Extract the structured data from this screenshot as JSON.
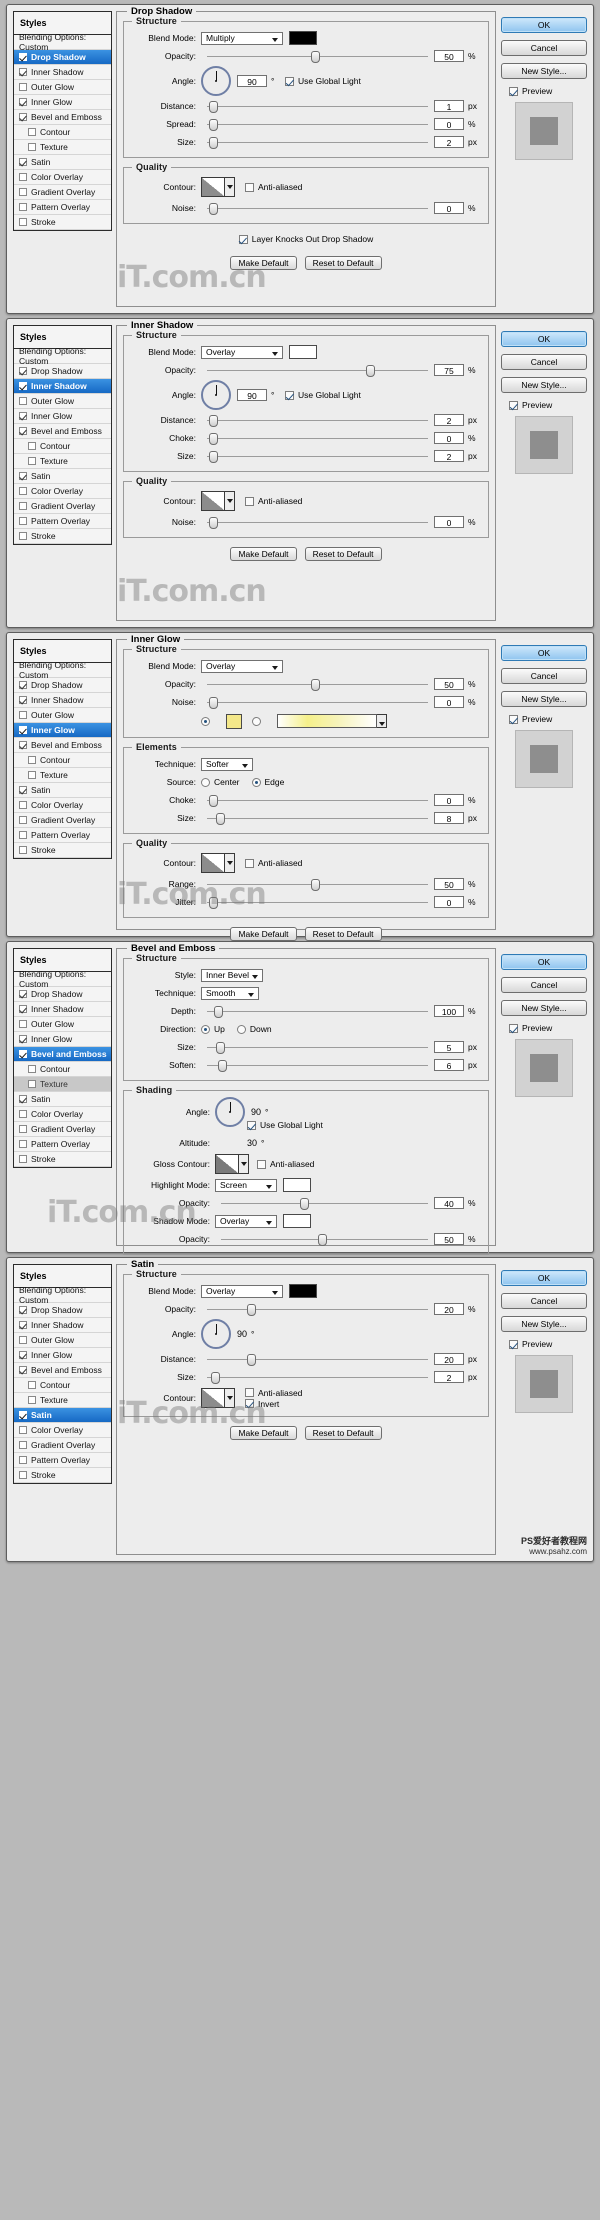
{
  "app": {
    "watermark": "iT.com.cn",
    "footer_line1": "PS爱好者教程网",
    "footer_line2": "www.psahz.com"
  },
  "common": {
    "styles_header": "Styles",
    "blending_options": "Blending Options: Custom",
    "style_items": [
      "Drop Shadow",
      "Inner Shadow",
      "Outer Glow",
      "Inner Glow",
      "Bevel and Emboss",
      "Contour",
      "Texture",
      "Satin",
      "Color Overlay",
      "Gradient Overlay",
      "Pattern Overlay",
      "Stroke"
    ],
    "buttons": {
      "ok": "OK",
      "cancel": "Cancel",
      "new_style": "New Style...",
      "preview": "Preview",
      "make_default": "Make Default",
      "reset_default": "Reset to Default"
    },
    "labels": {
      "structure": "Structure",
      "quality": "Quality",
      "elements": "Elements",
      "shading": "Shading",
      "blend_mode": "Blend Mode:",
      "opacity": "Opacity:",
      "angle": "Angle:",
      "distance": "Distance:",
      "spread": "Spread:",
      "size": "Size:",
      "choke": "Choke:",
      "noise": "Noise:",
      "contour": "Contour:",
      "anti_aliased": "Anti-aliased",
      "use_global_light": "Use Global Light",
      "layer_knocks_out": "Layer Knocks Out Drop Shadow",
      "technique": "Technique:",
      "source": "Source:",
      "center": "Center",
      "edge": "Edge",
      "range": "Range:",
      "jitter": "Jitter:",
      "style": "Style:",
      "depth": "Depth:",
      "direction": "Direction:",
      "up": "Up",
      "down": "Down",
      "soften": "Soften:",
      "altitude": "Altitude:",
      "gloss_contour": "Gloss Contour:",
      "highlight_mode": "Highlight Mode:",
      "shadow_mode": "Shadow Mode:",
      "invert": "Invert",
      "percent": "%",
      "px": "px",
      "deg": "°"
    }
  },
  "dialogs": [
    {
      "id": "drop-shadow",
      "title": "Drop Shadow",
      "selected_style": "Drop Shadow",
      "checked_styles": [
        "Drop Shadow",
        "Inner Shadow",
        "Inner Glow",
        "Bevel and Emboss",
        "Satin"
      ],
      "blend_mode": "Multiply",
      "swatch_color": "#000000",
      "opacity": "50",
      "angle": "90",
      "use_global_light": true,
      "distance": "1",
      "spread": "0",
      "size": "2",
      "anti_aliased": false,
      "noise": "0",
      "layer_knocks_out": true
    },
    {
      "id": "inner-shadow",
      "title": "Inner Shadow",
      "selected_style": "Inner Shadow",
      "checked_styles": [
        "Drop Shadow",
        "Inner Shadow",
        "Inner Glow",
        "Bevel and Emboss",
        "Satin"
      ],
      "blend_mode": "Overlay",
      "swatch_color": "#ffffff",
      "opacity": "75",
      "angle": "90",
      "use_global_light": true,
      "distance": "2",
      "choke": "0",
      "size": "2",
      "anti_aliased": false,
      "noise": "0"
    },
    {
      "id": "inner-glow",
      "title": "Inner Glow",
      "selected_style": "Inner Glow",
      "checked_styles": [
        "Drop Shadow",
        "Inner Shadow",
        "Inner Glow",
        "Bevel and Emboss",
        "Satin"
      ],
      "blend_mode": "Overlay",
      "opacity": "50",
      "noise": "0",
      "fill_type": "color",
      "glow_color": "#f4e88a",
      "technique": "Softer",
      "source": "Edge",
      "choke": "0",
      "size": "8",
      "anti_aliased": false,
      "range": "50",
      "jitter": "0"
    },
    {
      "id": "bevel-emboss",
      "title": "Bevel and Emboss",
      "selected_style": "Bevel and Emboss",
      "sub_selected": "Texture",
      "checked_styles": [
        "Drop Shadow",
        "Inner Shadow",
        "Inner Glow",
        "Bevel and Emboss",
        "Satin"
      ],
      "style": "Inner Bevel",
      "technique": "Smooth",
      "depth": "100",
      "direction": "Up",
      "size": "5",
      "soften": "6",
      "angle": "90",
      "use_global_light": true,
      "altitude": "30",
      "anti_aliased": false,
      "highlight_mode": "Screen",
      "highlight_color": "#ffffff",
      "highlight_opacity": "40",
      "shadow_mode": "Overlay",
      "shadow_color": "#ffffff",
      "shadow_opacity": "50"
    },
    {
      "id": "satin",
      "title": "Satin",
      "selected_style": "Satin",
      "checked_styles": [
        "Drop Shadow",
        "Inner Shadow",
        "Inner Glow",
        "Bevel and Emboss",
        "Satin"
      ],
      "blend_mode": "Overlay",
      "swatch_color": "#000000",
      "opacity": "20",
      "angle": "90",
      "distance": "20",
      "size": "2",
      "anti_aliased": false,
      "invert": true
    }
  ]
}
